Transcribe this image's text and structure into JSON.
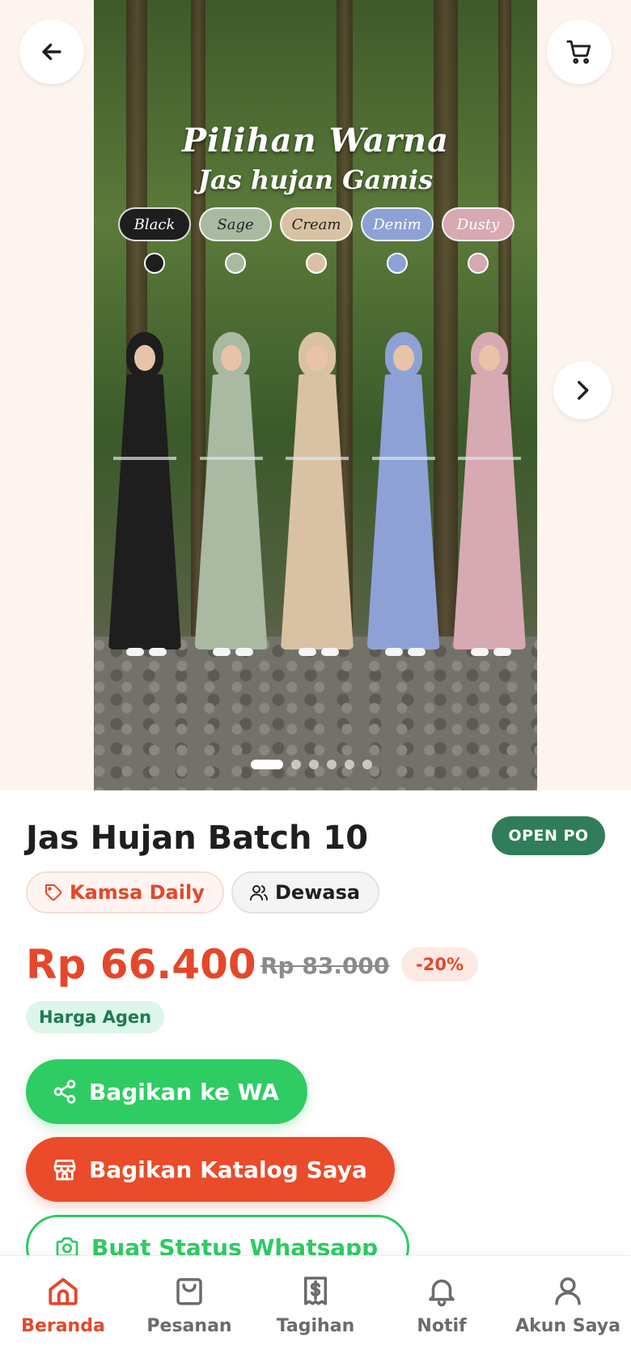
{
  "header": {
    "back_icon": "arrow-left-icon",
    "cart_icon": "cart-icon"
  },
  "gallery": {
    "headline_line1": "Pilihan Warna",
    "headline_line2": "Jas hujan Gamis",
    "colors": [
      {
        "label": "Black",
        "color": "#1e1e1e"
      },
      {
        "label": "Sage",
        "color": "#a9b9a2"
      },
      {
        "label": "Cream",
        "color": "#d9c2a3"
      },
      {
        "label": "Denim",
        "color": "#8ea1d6"
      },
      {
        "label": "Dusty",
        "color": "#d7a9b2"
      }
    ],
    "slide_count": 6,
    "active_slide": 1,
    "next_icon": "chevron-right-icon"
  },
  "product": {
    "title": "Jas Hujan Batch 10",
    "status": "OPEN PO",
    "brand": "Kamsa Daily",
    "category": "Dewasa",
    "price": "Rp 66.400",
    "old_price": "Rp 83.000",
    "discount": "-20%",
    "price_type": "Harga Agen"
  },
  "actions": {
    "share_wa": "Bagikan ke WA",
    "share_catalog": "Bagikan Katalog Saya",
    "create_status": "Buat Status Whatsapp"
  },
  "nav": {
    "items": [
      {
        "label": "Beranda",
        "icon": "home-icon"
      },
      {
        "label": "Pesanan",
        "icon": "bag-icon"
      },
      {
        "label": "Tagihan",
        "icon": "receipt-icon"
      },
      {
        "label": "Notif",
        "icon": "bell-icon"
      },
      {
        "label": "Akun Saya",
        "icon": "user-icon"
      }
    ],
    "active": "Beranda"
  },
  "colors": {
    "accent": "#e5472a",
    "whatsapp": "#2ecc63",
    "status_badge": "#2f7d5a"
  }
}
